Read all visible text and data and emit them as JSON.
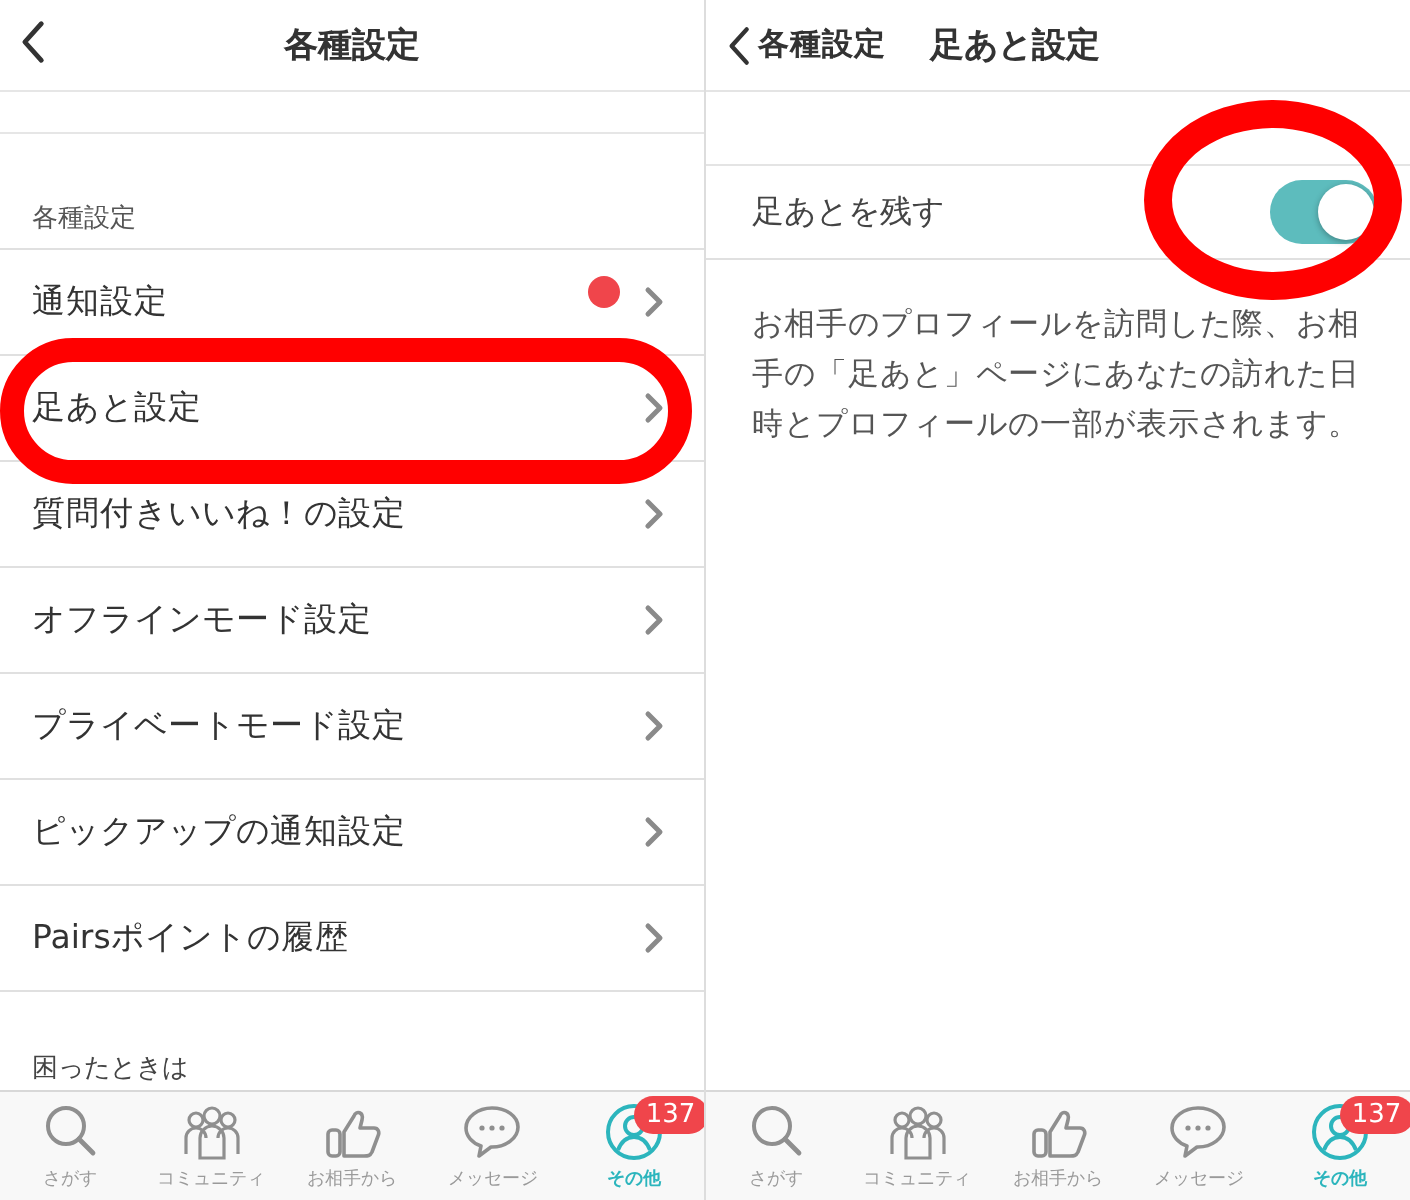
{
  "screens": [
    {
      "kind": "list",
      "header": {
        "title": "各種設定"
      },
      "section": {
        "title": "各種設定",
        "rows": [
          {
            "label": "通知設定",
            "badge": true,
            "highlighted": false
          },
          {
            "label": "足あと設定",
            "badge": false,
            "highlighted": true
          },
          {
            "label": "質問付きいいね！の設定",
            "badge": false,
            "highlighted": false
          },
          {
            "label": "オフラインモード設定",
            "badge": false,
            "highlighted": false
          },
          {
            "label": "プライベートモード設定",
            "badge": false,
            "highlighted": false
          },
          {
            "label": "ピックアップの通知設定",
            "badge": false,
            "highlighted": false
          },
          {
            "label": "Pairsポイントの履歴",
            "badge": false,
            "highlighted": false
          }
        ]
      },
      "footer_title": "困ったときは",
      "tabs": [
        {
          "label": "さがす",
          "selected": false
        },
        {
          "label": "コミュニティ",
          "selected": false
        },
        {
          "label": "お相手から",
          "selected": false
        },
        {
          "label": "メッセージ",
          "selected": false
        },
        {
          "label": "その他",
          "selected": true,
          "badge": "137"
        }
      ]
    },
    {
      "kind": "detail",
      "header": {
        "back_label": "各種設定",
        "title": "足あと設定"
      },
      "toggle_row": {
        "label": "足あとを残す",
        "on": true,
        "highlighted": true
      },
      "description": "お相手のプロフィールを訪問した際、お相手の「足あと」ページにあなたの訪れた日時とプロフィールの一部が表示されます。",
      "tabs": [
        {
          "label": "さがす",
          "selected": false
        },
        {
          "label": "コミュニティ",
          "selected": false
        },
        {
          "label": "お相手から",
          "selected": false
        },
        {
          "label": "メッセージ",
          "selected": false
        },
        {
          "label": "その他",
          "selected": true,
          "badge": "137"
        }
      ]
    }
  ]
}
